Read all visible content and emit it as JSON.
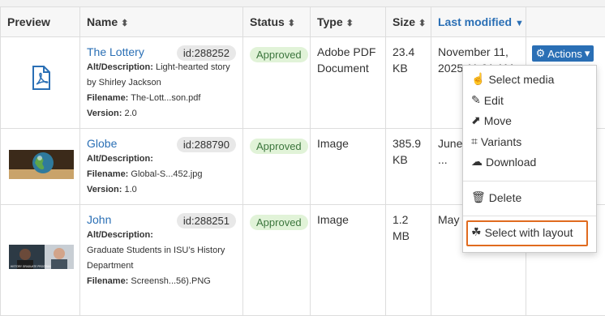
{
  "headers": {
    "preview": "Preview",
    "name": "Name",
    "status": "Status",
    "type": "Type",
    "size": "Size",
    "last_modified": "Last modified"
  },
  "rows": [
    {
      "title": "The Lottery",
      "id": "id:288252",
      "alt_label": "Alt/Description:",
      "alt_text": "Light-hearted story by Shirley Jackson",
      "filename_label": "Filename:",
      "filename": "The-Lott...son.pdf",
      "version_label": "Version:",
      "version": "2.0",
      "status": "Approved",
      "type": "Adobe PDF Document",
      "size": "23.4 KB",
      "modified": "November 11, 2025 11:01 AM"
    },
    {
      "title": "Globe",
      "id": "id:288790",
      "alt_label": "Alt/Description:",
      "alt_text": "",
      "filename_label": "Filename:",
      "filename": "Global-S...452.jpg",
      "version_label": "Version:",
      "version": "1.0",
      "status": "Approved",
      "type": "Image",
      "size": "385.9 KB",
      "modified": "June ... 12:30 ..."
    },
    {
      "title": "John",
      "id": "id:288251",
      "alt_label": "Alt/Description:",
      "alt_text": "Graduate Students in ISU’s History Department",
      "filename_label": "Filename:",
      "filename": "Screensh...56).PNG",
      "version_label": "",
      "version": "",
      "status": "Approved",
      "type": "Image",
      "size": "1.2 MB",
      "modified": "May ... 10:38 ..."
    }
  ],
  "actions": {
    "label": "Actions"
  },
  "menu": {
    "select_media": "Select media",
    "edit": "Edit",
    "move": "Move",
    "variants": "Variants",
    "download": "Download",
    "delete": "Delete",
    "select_with_layout": "Select with layout"
  },
  "thumb_text": {
    "john_caption": "HISTORY GRADUATE PROGRAM"
  },
  "colors": {
    "link": "#2a6fb5",
    "approved_bg": "#e1f3d8",
    "approved_text": "#3c763d",
    "highlight": "#e06b1f"
  }
}
